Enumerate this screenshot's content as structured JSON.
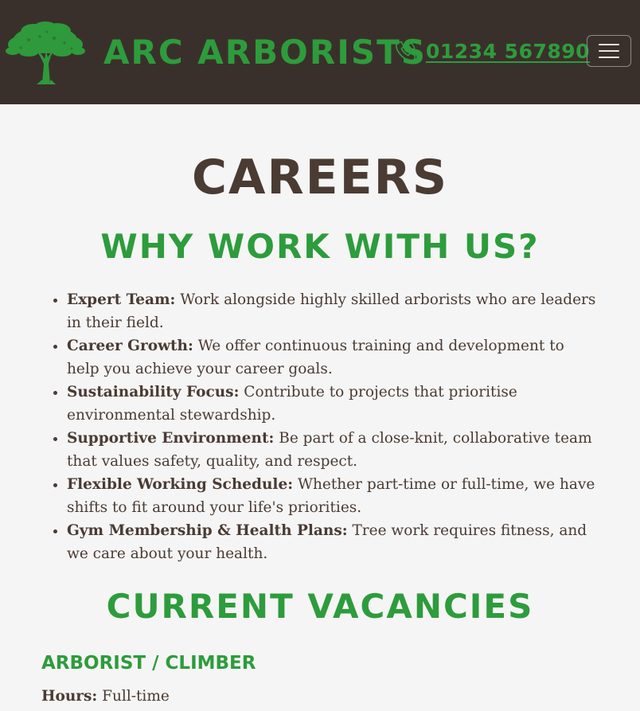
{
  "header": {
    "brand": "ARC ARBORISTS",
    "logo_icon": "tree-logo-icon",
    "phone_icon": "phone-icon",
    "phone_number": "01234 567890",
    "menu_icon": "hamburger-menu-icon",
    "colors": {
      "background": "#3a302b",
      "accent": "#2d9c3c"
    }
  },
  "main": {
    "title": "CAREERS",
    "why_heading": "WHY WORK WITH US?",
    "benefits": [
      {
        "label": "Expert Team:",
        "text": "Work alongside highly skilled arborists who are leaders in their field."
      },
      {
        "label": "Career Growth:",
        "text": "We offer continuous training and development to help you achieve your career goals."
      },
      {
        "label": "Sustainability Focus:",
        "text": "Contribute to projects that prioritise environmental stewardship."
      },
      {
        "label": "Supportive Environment:",
        "text": "Be part of a close-knit, collaborative team that values safety, quality, and respect."
      },
      {
        "label": "Flexible Working Schedule:",
        "text": "Whether part-time or full-time, we have shifts to fit around your life's priorities."
      },
      {
        "label": "Gym Membership & Health Plans:",
        "text": "Tree work requires fitness, and we care about your health."
      }
    ],
    "vacancies_heading": "CURRENT VACANCIES",
    "job": {
      "title": "ARBORIST / CLIMBER",
      "hours_label": "Hours:",
      "hours_value": "Full-time"
    },
    "colors": {
      "title": "#4a3b33",
      "heading": "#2d9c3c",
      "body_text": "#4a3b33",
      "page_background": "#f5f5f5"
    }
  }
}
